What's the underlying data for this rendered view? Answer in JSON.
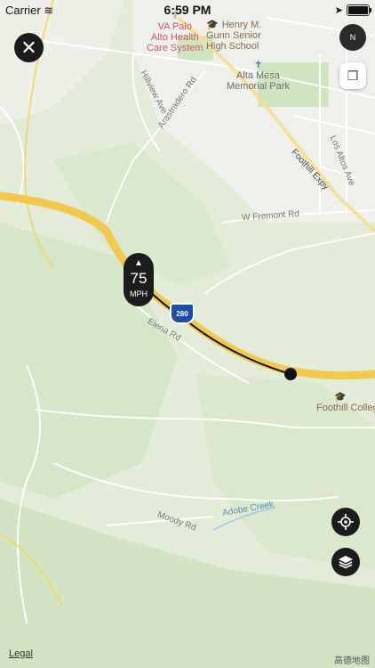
{
  "status": {
    "carrier": "Carrier",
    "time": "6:59 PM"
  },
  "controls": {
    "close_icon": "close-icon",
    "compass_label": "N",
    "speed_value": "75",
    "speed_unit": "MPH",
    "recenter_icon": "crosshair-icon",
    "layers_icon": "layers-icon"
  },
  "map": {
    "poi": {
      "va_palo_alto": "VA Palo\nAlto Health\nCare System",
      "gunn": "Henry M.\nGunn Senior\nHigh School",
      "alta_mesa": "Alta Mesa\nMemorial Park",
      "foothill": "Foothill College"
    },
    "roads": {
      "hillview": "Hillview Ave",
      "arastradero": "Arastradero Rd",
      "foothill_expy": "Foothill Expy",
      "los_altos": "Los Altos Ave",
      "w_fremont": "W Fremont Rd",
      "elena": "Elena Rd",
      "moody": "Moody Rd",
      "adobe_creek": "Adobe Creek"
    },
    "shield": "280"
  },
  "footer": {
    "legal": "Legal",
    "attribution": "高德地图"
  }
}
